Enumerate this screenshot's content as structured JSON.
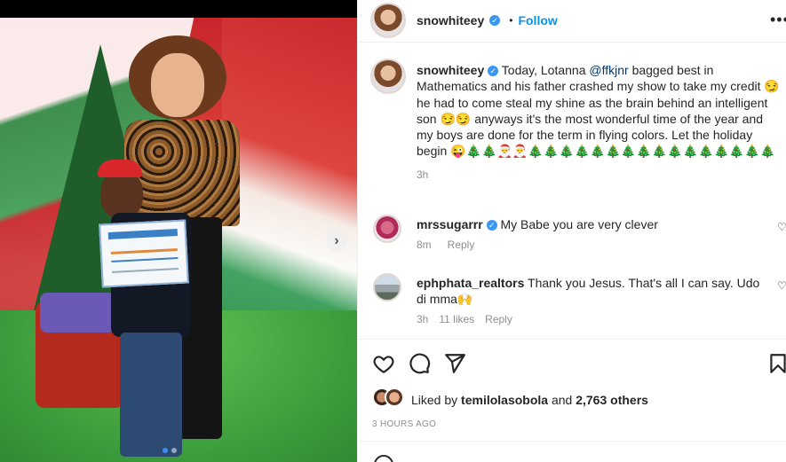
{
  "post": {
    "username": "snowhiteey",
    "follow_label": "Follow",
    "separator": "•",
    "more_label": "•••",
    "carousel_dots": 2,
    "carousel_active": 0,
    "next_label": "›"
  },
  "caption": {
    "username": "snowhiteey",
    "text_part1": "Today, Lotanna ",
    "mention": "@ffkjnr",
    "text_part2": " bagged best in Mathematics and his father crashed my show to take my credit 😏he had to come steal my shine as the brain behind an intelligent son 😏😏 anyways it's the most wonderful time of the year and my boys are done for the term in flying colors. Let the holiday begin 😜🎄🎄🎅🎅🎄🎄🎄🎄🎄🎄🎄🎄🎄🎄🎄🎄🎄🎄🎄🎄",
    "time": "3h"
  },
  "comments": [
    {
      "username": "mrssugarrr",
      "verified": true,
      "text": "My Babe you are very clever",
      "time": "8m",
      "likes": "",
      "reply": "Reply"
    },
    {
      "username": "ephphata_realtors",
      "verified": false,
      "text": "Thank you Jesus. That's all I can say. Udo di mma🙌",
      "time": "3h",
      "likes": "11 likes",
      "reply": "Reply"
    }
  ],
  "likes": {
    "prefix": "Liked by ",
    "user": "temilolasobola",
    "middle": " and ",
    "count": "2,763 others"
  },
  "timestamp": "3 HOURS AGO",
  "icons": [
    "heart-icon",
    "comment-icon",
    "share-icon",
    "bookmark-icon",
    "chevron-right-icon"
  ],
  "colors": {
    "follow": "#0095f6",
    "verified": "#3897f0",
    "mention": "#00376b"
  }
}
